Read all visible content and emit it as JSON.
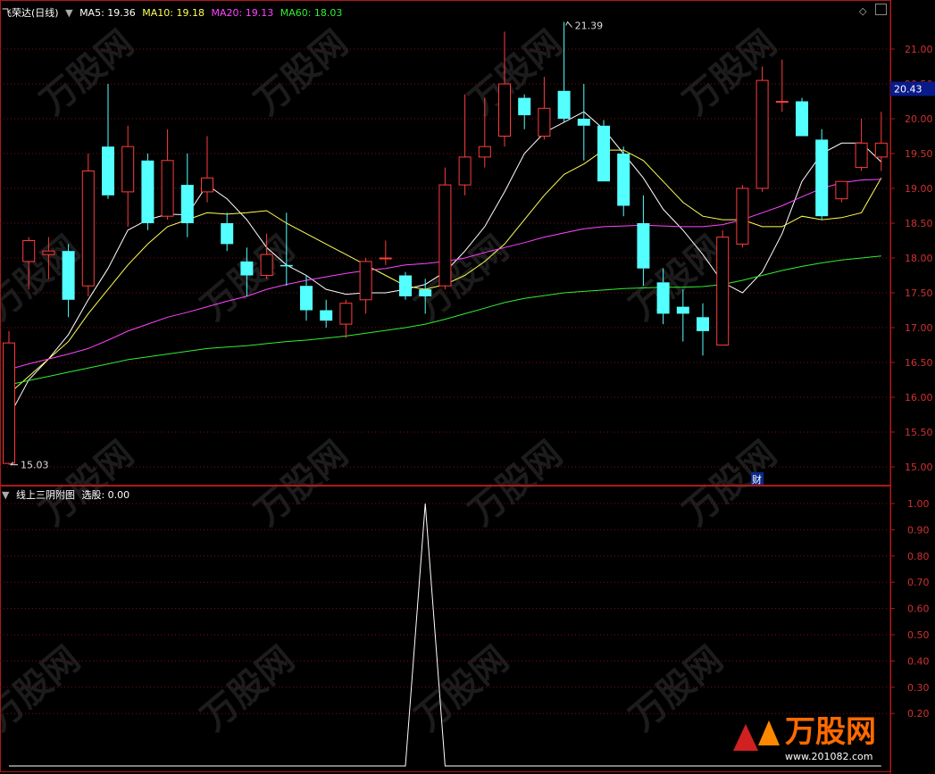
{
  "main_panel": {
    "title": "飞荣达(日线)",
    "ma_labels": [
      {
        "text": "MA5: 19.36",
        "color": "#ffffff"
      },
      {
        "text": "MA10: 19.18",
        "color": "#ffff55"
      },
      {
        "text": "MA20: 19.13",
        "color": "#ff44ff"
      },
      {
        "text": "MA60: 18.03",
        "color": "#33ee33"
      }
    ],
    "high_label": "21.39",
    "low_label": "15.03",
    "current_price": "20.43",
    "finance_marker": "财"
  },
  "sub_panel": {
    "title": "线上三阴附图",
    "value_label": "选股: 0.00"
  },
  "watermark": {
    "brand": "万股网",
    "url": "www.201082.com"
  },
  "chart_data": [
    {
      "type": "candlestick",
      "ylim": [
        14.95,
        21.45
      ],
      "y_ticks": [
        "21.00",
        "20.50",
        "20.00",
        "19.50",
        "19.00",
        "18.50",
        "18.00",
        "17.50",
        "17.00",
        "16.50",
        "16.00",
        "15.50",
        "15.00"
      ],
      "candles": [
        {
          "o": 15.05,
          "h": 16.95,
          "l": 15.03,
          "c": 16.78
        },
        {
          "o": 17.95,
          "h": 18.3,
          "l": 17.55,
          "c": 18.25
        },
        {
          "o": 18.05,
          "h": 18.3,
          "l": 17.7,
          "c": 18.1
        },
        {
          "o": 18.1,
          "h": 18.2,
          "l": 17.15,
          "c": 17.4
        },
        {
          "o": 17.6,
          "h": 19.5,
          "l": 17.45,
          "c": 19.25
        },
        {
          "o": 19.6,
          "h": 20.5,
          "l": 18.85,
          "c": 18.9
        },
        {
          "o": 18.95,
          "h": 19.9,
          "l": 18.45,
          "c": 19.6
        },
        {
          "o": 19.4,
          "h": 19.5,
          "l": 18.4,
          "c": 18.5
        },
        {
          "o": 18.6,
          "h": 19.85,
          "l": 18.55,
          "c": 19.4
        },
        {
          "o": 19.05,
          "h": 19.5,
          "l": 18.3,
          "c": 18.5
        },
        {
          "o": 18.95,
          "h": 19.75,
          "l": 18.8,
          "c": 19.15
        },
        {
          "o": 18.5,
          "h": 18.65,
          "l": 18.1,
          "c": 18.2
        },
        {
          "o": 17.95,
          "h": 18.15,
          "l": 17.45,
          "c": 17.75
        },
        {
          "o": 17.75,
          "h": 18.35,
          "l": 17.7,
          "c": 18.05
        },
        {
          "o": 17.9,
          "h": 18.65,
          "l": 17.6,
          "c": 17.88
        },
        {
          "o": 17.6,
          "h": 17.75,
          "l": 17.1,
          "c": 17.25
        },
        {
          "o": 17.25,
          "h": 17.4,
          "l": 17.0,
          "c": 17.1
        },
        {
          "o": 17.05,
          "h": 17.4,
          "l": 16.85,
          "c": 17.35
        },
        {
          "o": 17.4,
          "h": 18.0,
          "l": 17.2,
          "c": 17.95
        },
        {
          "o": 18.0,
          "h": 18.25,
          "l": 17.9,
          "c": 18.0
        },
        {
          "o": 17.75,
          "h": 17.8,
          "l": 17.4,
          "c": 17.45
        },
        {
          "o": 17.55,
          "h": 17.7,
          "l": 17.2,
          "c": 17.45
        },
        {
          "o": 17.6,
          "h": 19.3,
          "l": 17.55,
          "c": 19.05
        },
        {
          "o": 19.05,
          "h": 20.35,
          "l": 18.9,
          "c": 19.45
        },
        {
          "o": 19.45,
          "h": 20.3,
          "l": 19.3,
          "c": 19.6
        },
        {
          "o": 19.75,
          "h": 21.25,
          "l": 19.6,
          "c": 20.5
        },
        {
          "o": 20.3,
          "h": 20.35,
          "l": 19.85,
          "c": 20.05
        },
        {
          "o": 19.75,
          "h": 20.6,
          "l": 19.7,
          "c": 20.15
        },
        {
          "o": 20.4,
          "h": 21.39,
          "l": 19.95,
          "c": 20.0
        },
        {
          "o": 20.0,
          "h": 20.5,
          "l": 19.4,
          "c": 19.9
        },
        {
          "o": 19.9,
          "h": 19.98,
          "l": 19.1,
          "c": 19.1
        },
        {
          "o": 19.5,
          "h": 19.6,
          "l": 18.6,
          "c": 18.75
        },
        {
          "o": 18.5,
          "h": 18.9,
          "l": 17.6,
          "c": 17.85
        },
        {
          "o": 17.65,
          "h": 17.85,
          "l": 17.05,
          "c": 17.2
        },
        {
          "o": 17.3,
          "h": 17.55,
          "l": 16.8,
          "c": 17.2
        },
        {
          "o": 17.15,
          "h": 17.35,
          "l": 16.6,
          "c": 16.95
        },
        {
          "o": 16.75,
          "h": 18.4,
          "l": 16.75,
          "c": 18.3
        },
        {
          "o": 18.2,
          "h": 19.05,
          "l": 18.15,
          "c": 19.0
        },
        {
          "o": 19.0,
          "h": 20.75,
          "l": 18.95,
          "c": 20.55
        },
        {
          "o": 20.25,
          "h": 20.85,
          "l": 20.1,
          "c": 20.25
        },
        {
          "o": 20.25,
          "h": 20.3,
          "l": 19.75,
          "c": 19.75
        },
        {
          "o": 19.7,
          "h": 19.85,
          "l": 18.55,
          "c": 18.6
        },
        {
          "o": 18.85,
          "h": 19.1,
          "l": 18.8,
          "c": 19.1
        },
        {
          "o": 19.3,
          "h": 20.0,
          "l": 19.25,
          "c": 19.65
        },
        {
          "o": 19.45,
          "h": 20.1,
          "l": 19.25,
          "c": 19.65
        }
      ],
      "ma_series": [
        {
          "name": "MA5",
          "color": "#ffffff",
          "values": [
            15.72,
            16.25,
            16.55,
            16.9,
            17.4,
            17.85,
            18.4,
            18.55,
            18.63,
            18.62,
            19.05,
            18.85,
            18.55,
            18.15,
            17.9,
            17.75,
            17.55,
            17.48,
            17.5,
            17.5,
            17.55,
            17.62,
            17.8,
            18.1,
            18.45,
            18.95,
            19.5,
            19.8,
            19.95,
            20.1,
            19.85,
            19.5,
            19.15,
            18.7,
            18.4,
            18.05,
            17.65,
            17.5,
            17.8,
            18.35,
            19.1,
            19.5,
            19.65,
            19.65,
            19.38
          ]
        },
        {
          "name": "MA10",
          "color": "#ffff55",
          "values": [
            16.05,
            16.3,
            16.55,
            16.8,
            17.2,
            17.55,
            17.9,
            18.2,
            18.45,
            18.55,
            18.65,
            18.63,
            18.65,
            18.68,
            18.5,
            18.35,
            18.2,
            18.05,
            17.9,
            17.75,
            17.6,
            17.55,
            17.62,
            17.75,
            17.95,
            18.2,
            18.55,
            18.9,
            19.2,
            19.35,
            19.55,
            19.55,
            19.4,
            19.1,
            18.8,
            18.6,
            18.55,
            18.55,
            18.45,
            18.45,
            18.6,
            18.55,
            18.58,
            18.65,
            19.15
          ]
        },
        {
          "name": "MA20",
          "color": "#ff44ff",
          "values": [
            16.4,
            16.48,
            16.55,
            16.62,
            16.7,
            16.82,
            16.95,
            17.05,
            17.15,
            17.22,
            17.3,
            17.38,
            17.45,
            17.55,
            17.62,
            17.68,
            17.73,
            17.78,
            17.82,
            17.85,
            17.9,
            17.92,
            17.95,
            18.0,
            18.08,
            18.15,
            18.22,
            18.3,
            18.36,
            18.42,
            18.45,
            18.46,
            18.47,
            18.46,
            18.45,
            18.45,
            18.48,
            18.55,
            18.65,
            18.75,
            18.88,
            19.0,
            19.08,
            19.12,
            19.13
          ]
        },
        {
          "name": "MA60",
          "color": "#33ee33",
          "values": [
            16.18,
            16.24,
            16.3,
            16.36,
            16.42,
            16.48,
            16.54,
            16.58,
            16.62,
            16.66,
            16.7,
            16.72,
            16.74,
            16.77,
            16.8,
            16.82,
            16.85,
            16.88,
            16.92,
            16.96,
            17.0,
            17.05,
            17.12,
            17.2,
            17.28,
            17.36,
            17.42,
            17.46,
            17.5,
            17.52,
            17.54,
            17.56,
            17.57,
            17.58,
            17.58,
            17.59,
            17.62,
            17.68,
            17.75,
            17.82,
            17.88,
            17.93,
            17.97,
            18.0,
            18.03
          ]
        }
      ]
    },
    {
      "type": "line",
      "ylim": [
        0,
        1.0
      ],
      "y_ticks": [
        "1.00",
        "0.90",
        "0.80",
        "0.70",
        "0.60",
        "0.50",
        "0.40",
        "0.30",
        "0.20"
      ],
      "series": [
        {
          "name": "选股",
          "color": "#ffffff",
          "values": [
            0,
            0,
            0,
            0,
            0,
            0,
            0,
            0,
            0,
            0,
            0,
            0,
            0,
            0,
            0,
            0,
            0,
            0,
            0,
            0,
            0,
            1,
            0,
            0,
            0,
            0,
            0,
            0,
            0,
            0,
            0,
            0,
            0,
            0,
            0,
            0,
            0,
            0,
            0,
            0,
            0,
            0,
            0,
            0,
            0
          ]
        }
      ]
    }
  ]
}
